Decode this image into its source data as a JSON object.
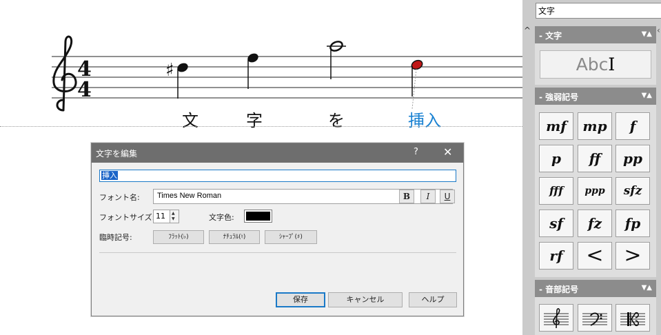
{
  "score": {
    "time_sig_top": "4",
    "time_sig_bottom": "4",
    "sharp": "♯",
    "lyrics": [
      "文",
      "字",
      "を",
      "挿入"
    ]
  },
  "dialog": {
    "title": "文字を編集",
    "help": "?",
    "close": "✕",
    "text_value": "挿入",
    "font_name_label": "フォント名:",
    "font_name_value": "Times New Roman",
    "bold": "B",
    "italic": "I",
    "underline": "U",
    "font_size_label": "フォントサイズ:",
    "font_size_value": "11",
    "text_color_label": "文字色:",
    "text_color": "#000000",
    "accidental_label": "臨時記号:",
    "flat_btn": "ﾌﾗｯﾄ(♭)",
    "natural_btn": "ﾅﾁｭﾗﾙ(♮)",
    "sharp_btn": "ｼｬｰﾌﾟ(♯)",
    "save": "保存",
    "cancel": "キャンセル",
    "help_btn": "ヘルプ"
  },
  "palette": {
    "dropdown_value": "文字",
    "text_header": "- 文字",
    "abc_label": "Abc",
    "abc_cursor": "I",
    "dynamics_header": "- 強弱記号",
    "dynamics": [
      "mf",
      "mp",
      "f",
      "p",
      "ff",
      "pp",
      "fff",
      "ppp",
      "sfz",
      "sf",
      "fz",
      "fp",
      "rf",
      "<",
      ">"
    ],
    "clef_header": "- 音部記号",
    "header_arrows": "▼▲"
  }
}
